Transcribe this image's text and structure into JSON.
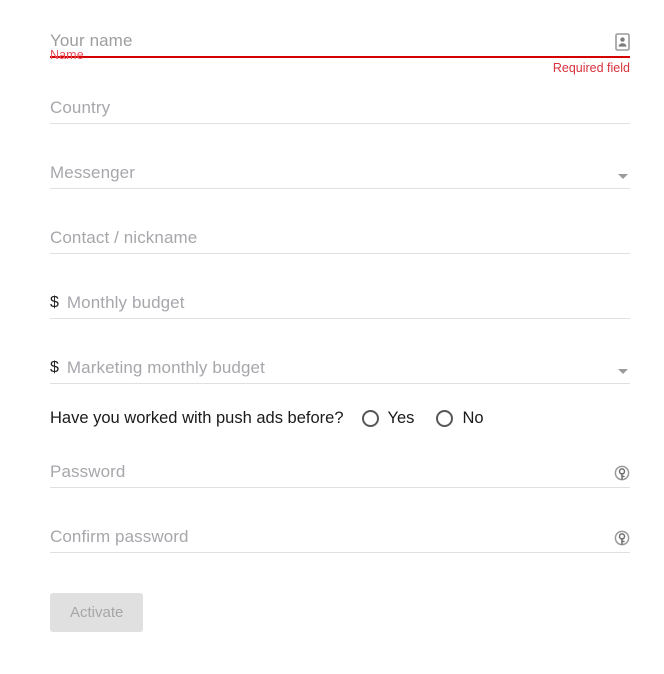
{
  "form": {
    "name_field": {
      "label": "Name",
      "placeholder": "Your name",
      "value": "",
      "error": "Required field",
      "icon": "contact-card-icon"
    },
    "country_field": {
      "placeholder": "Country",
      "value": ""
    },
    "messenger_field": {
      "placeholder": "Messenger",
      "value": "",
      "icon": "chevron-down-icon"
    },
    "contact_field": {
      "placeholder": "Contact / nickname",
      "value": ""
    },
    "monthly_budget_field": {
      "prefix": "$",
      "placeholder": "Monthly budget",
      "value": ""
    },
    "marketing_budget_field": {
      "prefix": "$",
      "placeholder": "Marketing monthly budget",
      "value": "",
      "icon": "chevron-down-icon"
    },
    "push_ads_question": {
      "question": "Have you worked with push ads before?",
      "options": [
        {
          "label": "Yes",
          "selected": false
        },
        {
          "label": "No",
          "selected": false
        }
      ]
    },
    "password_field": {
      "placeholder": "Password",
      "value": "",
      "icon": "password-key-icon"
    },
    "confirm_password_field": {
      "placeholder": "Confirm password",
      "value": "",
      "icon": "password-key-icon"
    },
    "submit_button": {
      "label": "Activate",
      "disabled": true
    }
  },
  "colors": {
    "error_red": "#d8323c",
    "accent_underline": "#d50000",
    "placeholder_gray": "#9e9e9e",
    "underline_gray": "#e0e0e2",
    "button_bg": "#e0e0e0",
    "button_text": "#a6a6a6"
  }
}
